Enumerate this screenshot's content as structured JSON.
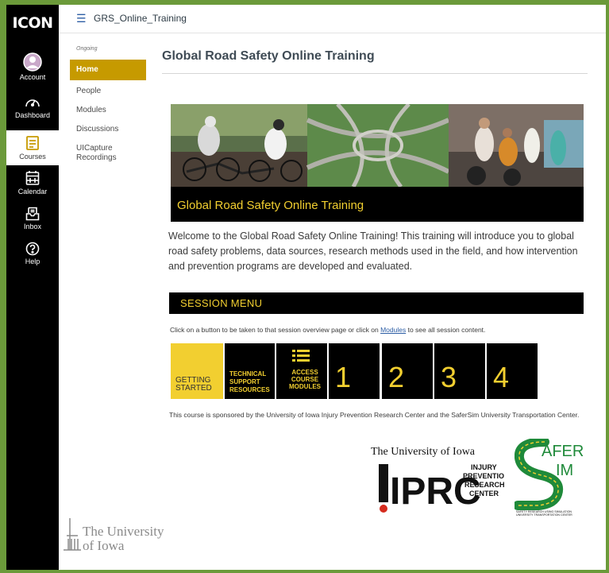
{
  "brand": {
    "logo_text": "ICON"
  },
  "global_nav": [
    {
      "label": "Account",
      "icon": "user-icon"
    },
    {
      "label": "Dashboard",
      "icon": "dashboard-icon"
    },
    {
      "label": "Courses",
      "icon": "courses-icon"
    },
    {
      "label": "Calendar",
      "icon": "calendar-icon"
    },
    {
      "label": "Inbox",
      "icon": "inbox-icon"
    },
    {
      "label": "Help",
      "icon": "help-icon"
    }
  ],
  "topbar": {
    "breadcrumb": "GRS_Online_Training"
  },
  "course_nav": {
    "term": "Ongoing",
    "items": [
      "Home",
      "People",
      "Modules",
      "Discussions",
      "UICapture Recordings"
    ]
  },
  "page": {
    "title": "Global Road Safety Online Training",
    "banner_caption": "Global Road Safety Online Training",
    "welcome": "Welcome to the Global Road Safety Online Training! This training will introduce you to global road safety problems, data sources, research methods used in the field, and how intervention and prevention programs are developed and evaluated.",
    "session_menu": "SESSION MENU",
    "hint_before": "Click on a button to be taken to that session overview page or click on ",
    "hint_link": "Modules",
    "hint_after": " to see all session content.",
    "tiles": {
      "getting_started": "GETTING STARTED",
      "technical": "TECHNICAL SUPPORT RESOURCES",
      "access": "ACCESS COURSE MODULES",
      "numbers": [
        "1",
        "2",
        "3",
        "4"
      ]
    },
    "sponsor": "This course is sponsored by the University of Iowa Injury Prevention Research Center and the SaferSim University Transportation Center."
  },
  "logos": {
    "uiowa_heading": "The University of Iowa",
    "iprc": "IPRC",
    "iprc_lines": [
      "INJURY",
      "PREVENTION",
      "RESEARCH",
      "CENTER"
    ],
    "safer": "AFER",
    "sim": "IM",
    "safer_tag1": "SAFETY RESEARCH USING SIMULATION",
    "safer_tag2": "UNIVERSITY TRANSPORTATION CENTER",
    "footer_line1": "The University",
    "footer_line2": "of Iowa"
  },
  "colors": {
    "accent": "#c69a00",
    "yellow": "#f2cf30",
    "nav_bg": "#000000",
    "frame": "#6b9a3a",
    "link": "#2d5ea5"
  }
}
